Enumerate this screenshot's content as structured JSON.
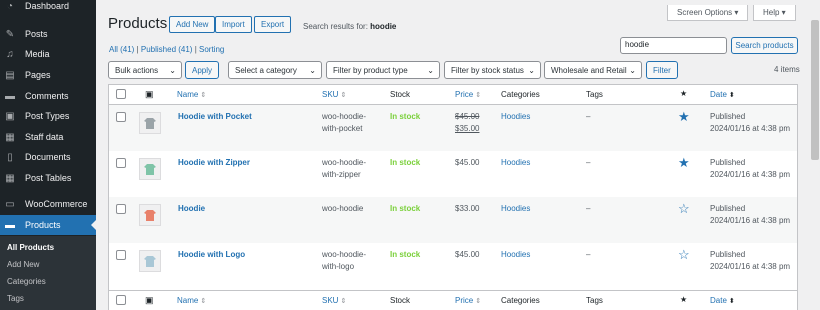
{
  "sidebar": {
    "items": [
      {
        "label": "Dashboard",
        "icon": "dashboard-icon"
      },
      {
        "label": "Posts",
        "icon": "pin-icon"
      },
      {
        "label": "Media",
        "icon": "media-icon"
      },
      {
        "label": "Pages",
        "icon": "pages-icon"
      },
      {
        "label": "Comments",
        "icon": "comments-icon"
      },
      {
        "label": "Post Types",
        "icon": "post-types-icon"
      },
      {
        "label": "Staff data",
        "icon": "staff-icon"
      },
      {
        "label": "Documents",
        "icon": "documents-icon"
      },
      {
        "label": "Post Tables",
        "icon": "table-icon"
      },
      {
        "label": "WooCommerce",
        "icon": "woo-icon"
      },
      {
        "label": "Products",
        "icon": "products-icon"
      }
    ],
    "submenu": [
      "All Products",
      "Add New",
      "Categories",
      "Tags"
    ]
  },
  "top": {
    "screen_options": "Screen Options ▾",
    "help": "Help ▾"
  },
  "header": {
    "title": "Products",
    "add_new": "Add New",
    "import": "Import",
    "export": "Export",
    "search_results_label": "Search results for:",
    "search_term": "hoodie"
  },
  "views": {
    "all": "All (41)",
    "sep1": " | ",
    "published": "Published (41)",
    "sep2": " | ",
    "sorting": "Sorting"
  },
  "search": {
    "value": "hoodie",
    "button": "Search products"
  },
  "filters": {
    "bulk_actions": "Bulk actions",
    "apply": "Apply",
    "category": "Select a category",
    "product_type": "Filter by product type",
    "stock_status": "Filter by stock status",
    "wholesale": "Wholesale and Retail",
    "filter": "Filter",
    "items_count": "4 items"
  },
  "columns": {
    "name": "Name",
    "sku": "SKU",
    "stock": "Stock",
    "price": "Price",
    "categories": "Categories",
    "tags": "Tags",
    "date": "Date"
  },
  "rows": [
    {
      "name": "Hoodie with Pocket",
      "sku1": "woo-hoodie-",
      "sku2": "with-pocket",
      "stock": "In stock",
      "price_old": "$45.00",
      "price_new": "$35.00",
      "category": "Hoodies",
      "tags": "–",
      "featured": true,
      "status": "Published",
      "date": "2024/01/16 at 4:38 pm",
      "thumb_color": "#9aa3a8"
    },
    {
      "name": "Hoodie with Zipper",
      "sku1": "woo-hoodie-",
      "sku2": "with-zipper",
      "stock": "In stock",
      "price": "$45.00",
      "category": "Hoodies",
      "tags": "–",
      "featured": true,
      "status": "Published",
      "date": "2024/01/16 at 4:38 pm",
      "thumb_color": "#7fc4a8"
    },
    {
      "name": "Hoodie",
      "sku1": "woo-hoodie",
      "sku2": "",
      "stock": "In stock",
      "price": "$33.00",
      "category": "Hoodies",
      "tags": "–",
      "featured": false,
      "status": "Published",
      "date": "2024/01/16 at 4:38 pm",
      "thumb_color": "#e8806a"
    },
    {
      "name": "Hoodie with Logo",
      "sku1": "woo-hoodie-",
      "sku2": "with-logo",
      "stock": "In stock",
      "price": "$45.00",
      "category": "Hoodies",
      "tags": "–",
      "featured": false,
      "status": "Published",
      "date": "2024/01/16 at 4:38 pm",
      "thumb_color": "#a9c7d6"
    }
  ]
}
